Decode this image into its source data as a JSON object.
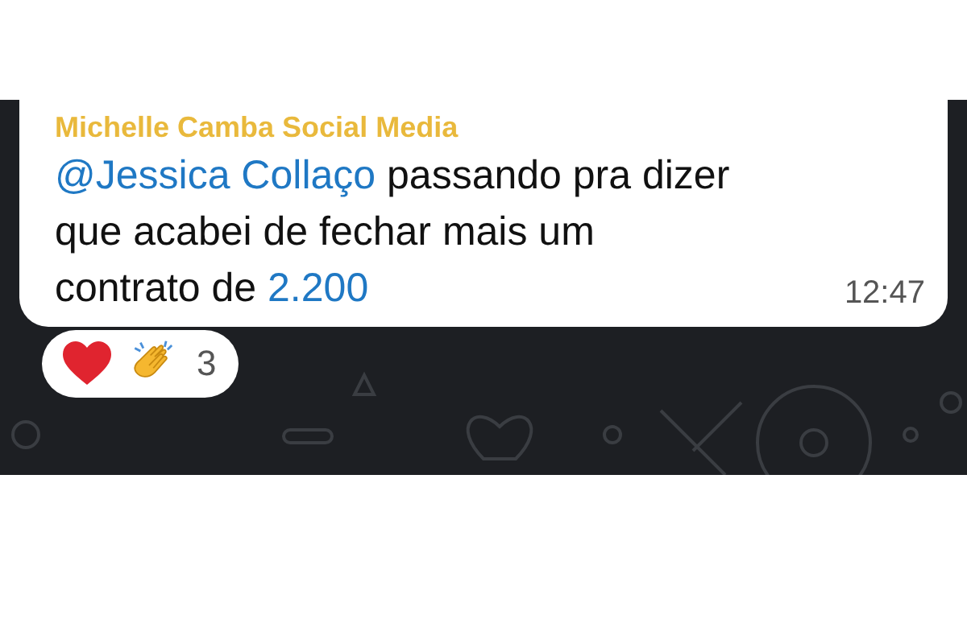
{
  "message": {
    "sender": "Michelle Camba Social Media",
    "parts": [
      {
        "kind": "mention",
        "text": "@Jessica Collaço"
      },
      {
        "kind": "text",
        "text": " passando pra dizer que acabei de fechar mais um contrato de "
      },
      {
        "kind": "link",
        "text": "2.200"
      }
    ],
    "time": "12:47"
  },
  "reactions": {
    "count": "3"
  }
}
